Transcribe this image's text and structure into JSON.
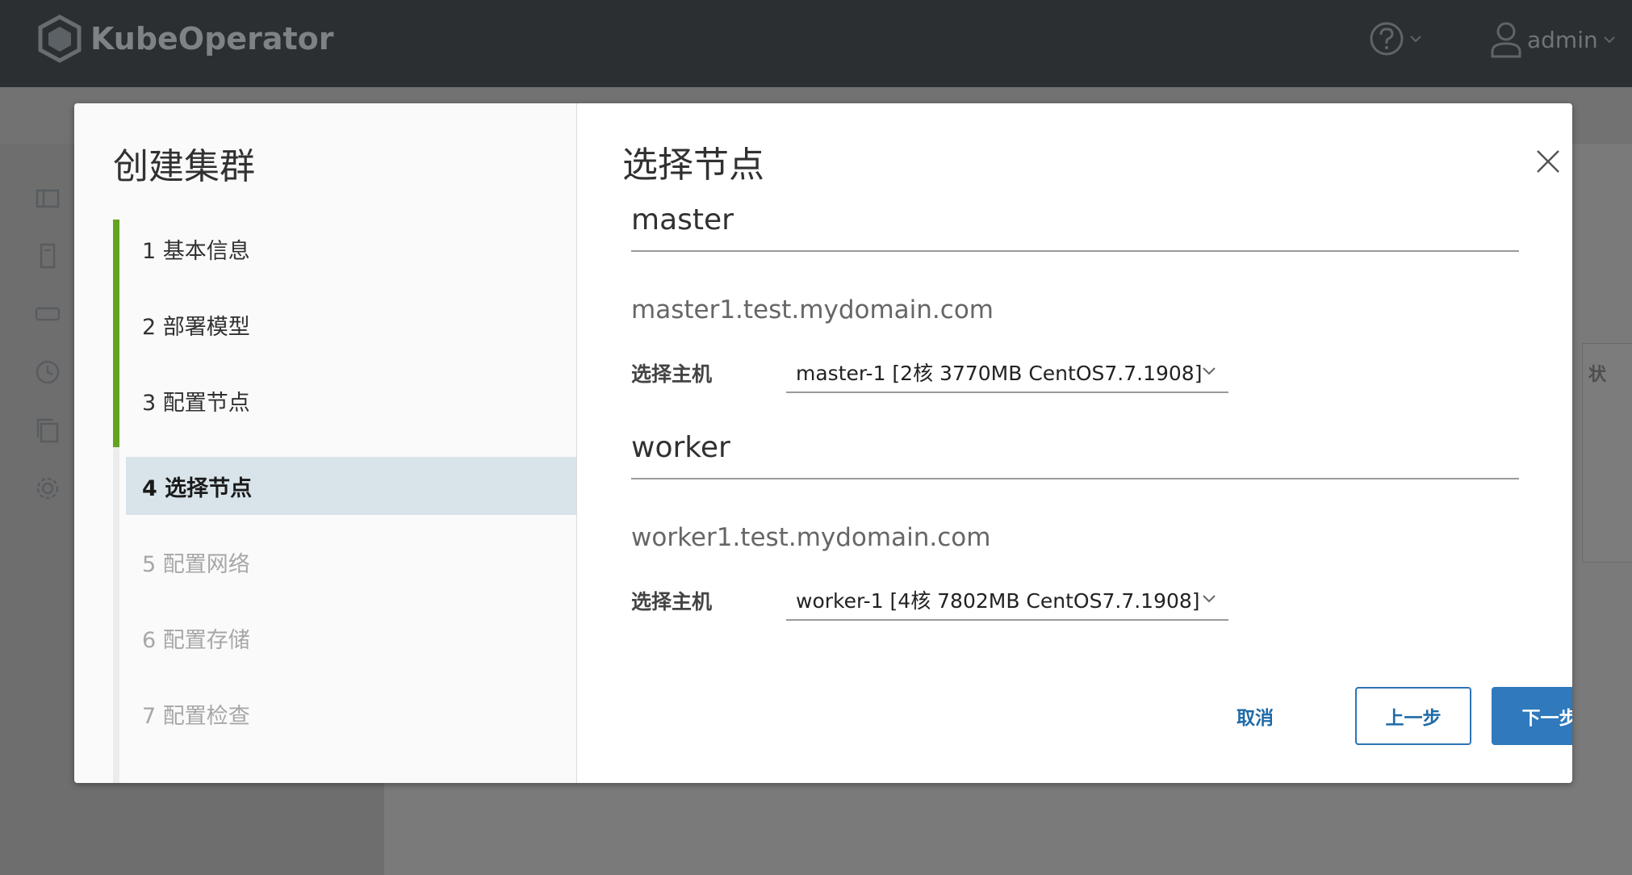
{
  "app": {
    "name": "KubeOperator",
    "user": "admin",
    "side_card_header": "状"
  },
  "wizard": {
    "title": "创建集群",
    "steps": [
      {
        "label": "1  基本信息",
        "state": "done"
      },
      {
        "label": "2  部署模型",
        "state": "done"
      },
      {
        "label": "3  配置节点",
        "state": "done"
      },
      {
        "label": "4  选择节点",
        "state": "active"
      },
      {
        "label": "5  配置网络",
        "state": "disabled"
      },
      {
        "label": "6  配置存储",
        "state": "disabled"
      },
      {
        "label": "7  配置检查",
        "state": "disabled"
      }
    ]
  },
  "page": {
    "title": "选择节点",
    "roles": [
      {
        "role": "master",
        "hostname": "master1.test.mydomain.com",
        "select_label": "选择主机",
        "selected_host": "master-1 [2核 3770MB CentOS7.7.1908]"
      },
      {
        "role": "worker",
        "hostname": "worker1.test.mydomain.com",
        "select_label": "选择主机",
        "selected_host": "worker-1 [4核 7802MB CentOS7.7.1908]"
      }
    ],
    "buttons": {
      "cancel": "取消",
      "prev": "上一步",
      "next": "下一步"
    }
  },
  "colors": {
    "primary": "#2f79bc",
    "step_done": "#62a420",
    "active_step_bg": "#d9e4ea"
  }
}
